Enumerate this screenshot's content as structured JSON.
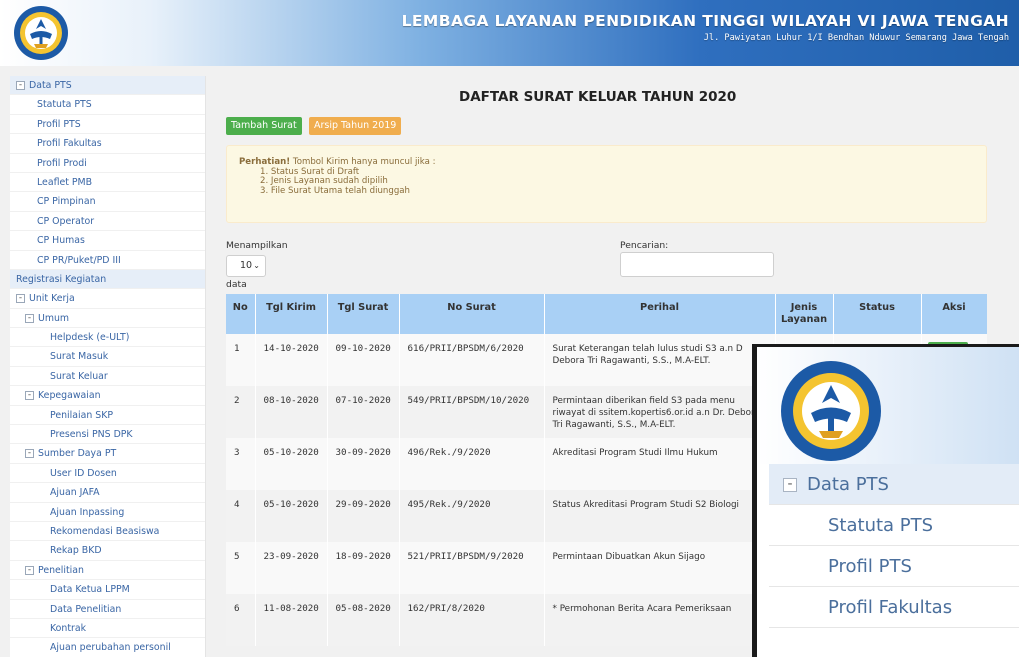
{
  "header": {
    "title": "LEMBAGA LAYANAN PENDIDIKAN TINGGI WILAYAH VI JAWA TENGAH",
    "address": "Jl. Pawiyatan Luhur 1/I Bendhan Nduwur Semarang Jawa Tengah",
    "logo_icon": "tut-wuri-handayani-logo"
  },
  "sidebar": {
    "items": [
      {
        "label": "Data PTS",
        "level": 0,
        "group": true,
        "toggle": "-"
      },
      {
        "label": "Statuta PTS",
        "level": 1
      },
      {
        "label": "Profil PTS",
        "level": 1
      },
      {
        "label": "Profil Fakultas",
        "level": 1
      },
      {
        "label": "Profil Prodi",
        "level": 1
      },
      {
        "label": "Leaflet PMB",
        "level": 1
      },
      {
        "label": "CP Pimpinan",
        "level": 1
      },
      {
        "label": "CP Operator",
        "level": 1
      },
      {
        "label": "CP Humas",
        "level": 1
      },
      {
        "label": "CP PR/Puket/PD III",
        "level": 1
      },
      {
        "label": "Registrasi Kegiatan",
        "level": 0,
        "group": true
      },
      {
        "label": "Unit Kerja",
        "level": 0,
        "toggle": "-"
      },
      {
        "label": "Umum",
        "level": 1,
        "toggle": "-"
      },
      {
        "label": "Helpdesk (e-ULT)",
        "level": 2
      },
      {
        "label": "Surat Masuk",
        "level": 2
      },
      {
        "label": "Surat Keluar",
        "level": 2
      },
      {
        "label": "Kepegawaian",
        "level": 1,
        "toggle": "-"
      },
      {
        "label": "Penilaian SKP",
        "level": 2
      },
      {
        "label": "Presensi PNS DPK",
        "level": 2
      },
      {
        "label": "Sumber Daya PT",
        "level": 1,
        "toggle": "-"
      },
      {
        "label": "User ID Dosen",
        "level": 2
      },
      {
        "label": "Ajuan JAFA",
        "level": 2
      },
      {
        "label": "Ajuan Inpassing",
        "level": 2
      },
      {
        "label": "Rekomendasi Beasiswa",
        "level": 2
      },
      {
        "label": "Rekap BKD",
        "level": 2
      },
      {
        "label": "Penelitian",
        "level": 1,
        "toggle": "-"
      },
      {
        "label": "Data Ketua LPPM",
        "level": 2
      },
      {
        "label": "Data Penelitian",
        "level": 2
      },
      {
        "label": "Kontrak",
        "level": 2
      },
      {
        "label": "Ajuan perubahan personil",
        "level": 2
      }
    ]
  },
  "main": {
    "title": "DAFTAR SURAT KELUAR TAHUN 2020",
    "buttons": {
      "add": "Tambah Surat",
      "archive": "Arsip Tahun 2019"
    },
    "notice": {
      "strong": "Perhatian!",
      "text": " Tombol Kirim hanya muncul jika :",
      "items": [
        "1. Status Surat di Draft",
        "2. Jenis Layanan sudah dipilih",
        "3. File Surat Utama telah diunggah"
      ]
    },
    "show_label": "Menampilkan",
    "show_value": "10",
    "data_label": "data",
    "search_label": "Pencarian:",
    "search_value": ""
  },
  "table": {
    "headers": [
      "No",
      "Tgl Kirim",
      "Tgl Surat",
      "No Surat",
      "Perihal",
      "Jenis Layanan",
      "Status",
      "Aksi"
    ],
    "rows": [
      {
        "no": "1",
        "tgl_kirim": "14-10-2020",
        "tgl_surat": "09-10-2020",
        "no_surat": "616/PRII/BPSDM/6/2020",
        "perihal": "Surat Keterangan telah lulus studi S3 a.n D Debora Tri Ragawanti, S.S., M.A-ELT."
      },
      {
        "no": "2",
        "tgl_kirim": "08-10-2020",
        "tgl_surat": "07-10-2020",
        "no_surat": "549/PRII/BPSDM/10/2020",
        "perihal": "Permintaan diberikan field S3 pada menu riwayat di ssitem.kopertis6.or.id a.n Dr. Debora Tri Ragawanti, S.S., M.A-ELT."
      },
      {
        "no": "3",
        "tgl_kirim": "05-10-2020",
        "tgl_surat": "30-09-2020",
        "no_surat": "496/Rek./9/2020",
        "perihal": "Akreditasi Program Studi Ilmu Hukum"
      },
      {
        "no": "4",
        "tgl_kirim": "05-10-2020",
        "tgl_surat": "29-09-2020",
        "no_surat": "495/Rek./9/2020",
        "perihal": "Status Akreditasi Program Studi S2 Biologi"
      },
      {
        "no": "5",
        "tgl_kirim": "23-09-2020",
        "tgl_surat": "18-09-2020",
        "no_surat": "521/PRII/BPSDM/9/2020",
        "perihal": "Permintaan Dibuatkan Akun Sijago"
      },
      {
        "no": "6",
        "tgl_kirim": "11-08-2020",
        "tgl_surat": "05-08-2020",
        "no_surat": "162/PRI/8/2020",
        "perihal": "* Permohonan Berita Acara Pemeriksaan"
      }
    ]
  },
  "inset": {
    "items": [
      {
        "label": "Data PTS",
        "group": true,
        "toggle": "-"
      },
      {
        "label": "Statuta PTS"
      },
      {
        "label": "Profil PTS"
      },
      {
        "label": "Profil Fakultas"
      }
    ]
  },
  "colors": {
    "accent_blue": "#3a66a5",
    "table_header": "#a9d0f5",
    "btn_green": "#4cae4c",
    "btn_orange": "#f0ad4e",
    "notice_bg": "#fcf8e3"
  }
}
